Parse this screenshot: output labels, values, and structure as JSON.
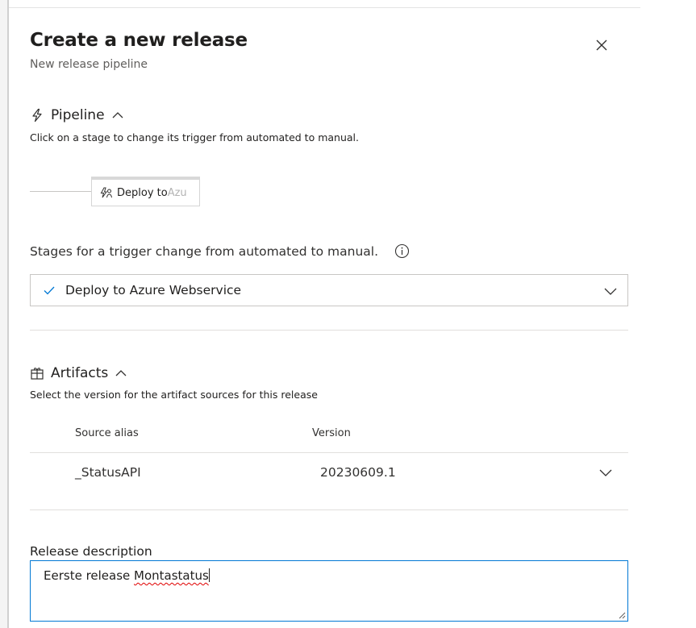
{
  "panel": {
    "title": "Create a new release",
    "subtitle": "New release pipeline"
  },
  "pipeline": {
    "heading": "Pipeline",
    "description": "Click on a stage to change its trigger from automated to manual.",
    "stage": {
      "label_visible": "Deploy to ",
      "label_faded": "Azu"
    }
  },
  "trigger": {
    "label": "Stages for a trigger change from automated to manual.",
    "selected_value": "Deploy to Azure Webservice"
  },
  "artifacts": {
    "heading": "Artifacts",
    "description": "Select the version for the artifact sources for this release",
    "columns": {
      "source_alias": "Source alias",
      "version": "Version"
    },
    "rows": [
      {
        "source_alias": "_StatusAPI",
        "version": "20230609.1"
      }
    ]
  },
  "release_description": {
    "label": "Release description",
    "value_prefix": "Eerste release ",
    "value_misspelled": "Montastatus"
  },
  "icons": {
    "close": "close-icon",
    "pipeline": "lightning-icon",
    "chevron_up": "chevron-up-icon",
    "stage": "stage-deploy-icon",
    "info": "info-icon",
    "check": "checkmark-icon",
    "chevron_down": "chevron-down-icon",
    "artifacts": "artifact-gift-icon"
  },
  "colors": {
    "accent": "#0078d4",
    "text": "#201f1e",
    "subtext": "#605e5c",
    "border": "#c8c6c4",
    "spellcheck": "#e00000"
  }
}
